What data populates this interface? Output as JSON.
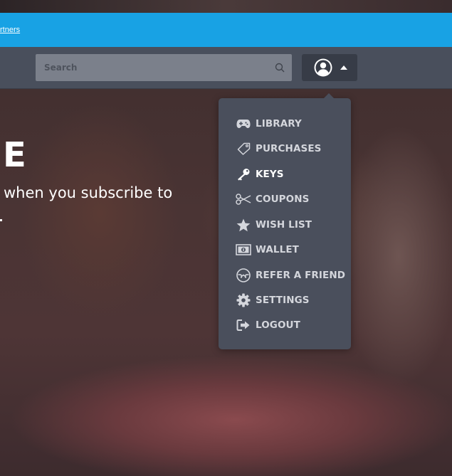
{
  "announcement": {
    "link_text": "rtners"
  },
  "navbar": {
    "search_placeholder": "Search",
    "account_icon": "user-circle-icon",
    "caret_icon": "caret-up-icon"
  },
  "hero": {
    "title": "E",
    "subtitle": "when you subscribe to"
  },
  "account_menu": {
    "items": [
      {
        "label": "LIBRARY",
        "icon": "gamepad-icon"
      },
      {
        "label": "PURCHASES",
        "icon": "tag-icon"
      },
      {
        "label": "KEYS",
        "icon": "key-icon",
        "highlighted": true
      },
      {
        "label": "COUPONS",
        "icon": "scissors-icon"
      },
      {
        "label": "WISH LIST",
        "icon": "star-icon"
      },
      {
        "label": "WALLET",
        "icon": "money-icon"
      },
      {
        "label": "REFER A FRIEND",
        "icon": "handshake-icon"
      },
      {
        "label": "SETTINGS",
        "icon": "gear-icon"
      },
      {
        "label": "LOGOUT",
        "icon": "sign-out-icon"
      }
    ]
  },
  "colors": {
    "announcement_bar": "#18a2e4",
    "navbar": "#494f5c",
    "dropdown": "#4a4f5c",
    "menu_text": "#d4d6dc"
  }
}
